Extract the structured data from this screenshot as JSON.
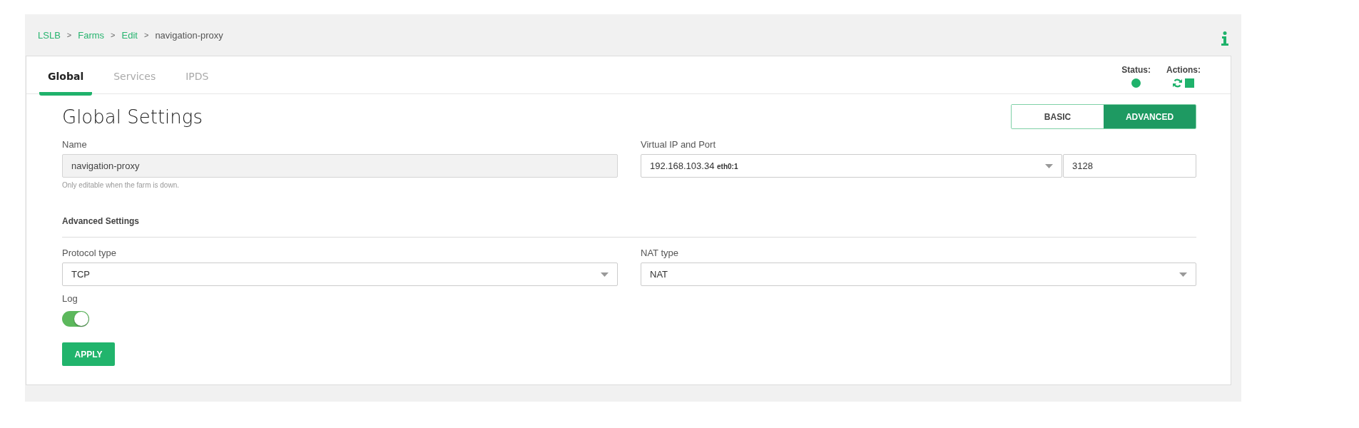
{
  "breadcrumb": [
    {
      "label": "LSLB",
      "kind": "link"
    },
    {
      "label": "Farms",
      "kind": "link"
    },
    {
      "label": "Edit",
      "kind": "link"
    },
    {
      "label": "navigation-proxy",
      "kind": "current"
    }
  ],
  "breadcrumb_separator": ">",
  "tabs": [
    {
      "label": "Global",
      "selected": true
    },
    {
      "label": "Services",
      "selected": false
    },
    {
      "label": "IPDS",
      "selected": false
    }
  ],
  "status": {
    "label": "Status:",
    "up": true
  },
  "actions": {
    "label": "Actions:"
  },
  "title": "Global Settings",
  "mode": [
    {
      "label": "BASIC",
      "selected": false
    },
    {
      "label": "ADVANCED",
      "selected": true
    }
  ],
  "name_field": {
    "label": "Name",
    "value": "navigation-proxy",
    "disabled": true,
    "hint": "Only editable when the farm is down."
  },
  "virtual_ip": {
    "label": "Virtual IP and Port",
    "address": "192.168.103.34",
    "interface": "eth0:1",
    "port": "3128"
  },
  "advanced_heading": "Advanced Settings",
  "protocol": {
    "label": "Protocol type",
    "value": "TCP"
  },
  "nat": {
    "label": "NAT type",
    "value": "NAT"
  },
  "log": {
    "label": "Log",
    "on": true
  },
  "apply_button": "APPLY"
}
